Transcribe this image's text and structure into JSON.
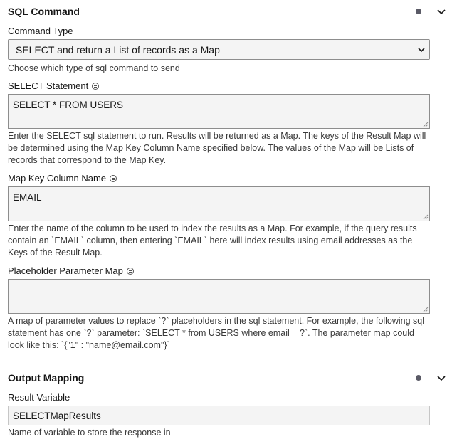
{
  "sql_command": {
    "title": "SQL Command",
    "command_type": {
      "label": "Command Type",
      "selected": "SELECT and return a List of records as a Map",
      "helper": "Choose which type of sql command to send"
    },
    "select_statement": {
      "label": "SELECT Statement",
      "value": "SELECT * FROM USERS",
      "helper": "Enter the SELECT sql statement to run. Results will be returned as a Map. The keys of the Result Map will be determined using the Map Key Column Name specified below. The values of the Map will be Lists of records that correspond to the Map Key."
    },
    "map_key_column": {
      "label": "Map Key Column Name",
      "value": "EMAIL",
      "helper": "Enter the name of the column to be used to index the results as a Map. For example, if the query results contain an `EMAIL` column, then entering `EMAIL` here will index results using email addresses as the Keys of the Result Map."
    },
    "placeholder_map": {
      "label": "Placeholder Parameter Map",
      "value": "",
      "helper": "A map of parameter values to replace `?` placeholders in the sql statement. For example, the following sql statement has one `?` parameter: `SELECT * from USERS where email = ?`. The parameter map could look like this: `{\"1\" : \"name@email.com\"}`"
    }
  },
  "output_mapping": {
    "title": "Output Mapping",
    "result_variable": {
      "label": "Result Variable",
      "value": "SELECTMapResults",
      "helper": "Name of variable to store the response in"
    }
  },
  "colors": {
    "dot": "#5a5a66",
    "field_bg": "#f4f4f4",
    "border": "#8d8d8d"
  },
  "icons": [
    "status-dot-icon",
    "chevron-down-icon",
    "info-icon",
    "select-arrow-icon",
    "resize-handle-icon"
  ]
}
